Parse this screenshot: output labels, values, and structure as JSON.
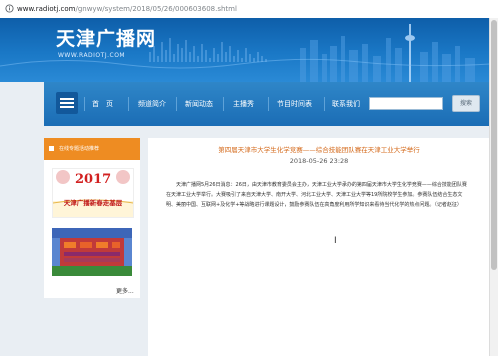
{
  "browser": {
    "url_domain": "www.radiotj.com",
    "url_path": "/gnwyw/system/2018/05/26/000603608.shtml"
  },
  "site": {
    "logo_cn": "天津广播网",
    "logo_en": "WWW.RADIOTJ.COM"
  },
  "nav": {
    "items": [
      {
        "label": "首　页"
      },
      {
        "label": "频道简介"
      },
      {
        "label": "新闻动态"
      },
      {
        "label": "主播秀"
      },
      {
        "label": "节目时间表"
      }
    ],
    "contact_label": "联系我们",
    "search_button": "搜索"
  },
  "sidebar": {
    "header": "在线专题活动推荐",
    "promo1_year": "2017",
    "promo1_label": "天津广播新春走基层",
    "more": "更多..."
  },
  "article": {
    "title": "第四届天津市大学生化学竞赛——综合技能团队赛在天津工业大学举行",
    "date": "2018-05-26 23:28",
    "body": "天津广播网5月26日消息：26日，由天津市教育委员会主办，天津工业大学承办的第四届天津市大学生化学竞赛——综合技能团队赛在天津工业大学举行。大赛吸引了来自天津大学、南开大学、河北工业大学、天津工业大学等19所院校学生参加。参赛队伍结合生态文明、美丽中国、互联网+及化学+等战略进行课题设计，鼓励参赛队伍在高角度利用所学知识来看待当代化学的热点问题。（记者赵征）"
  },
  "colors": {
    "banner": "#1a78c6",
    "nav": "#1b6db5",
    "sidebar_header": "#ee8c22",
    "title": "#d4691a",
    "page_bg": "#e9eef3"
  }
}
